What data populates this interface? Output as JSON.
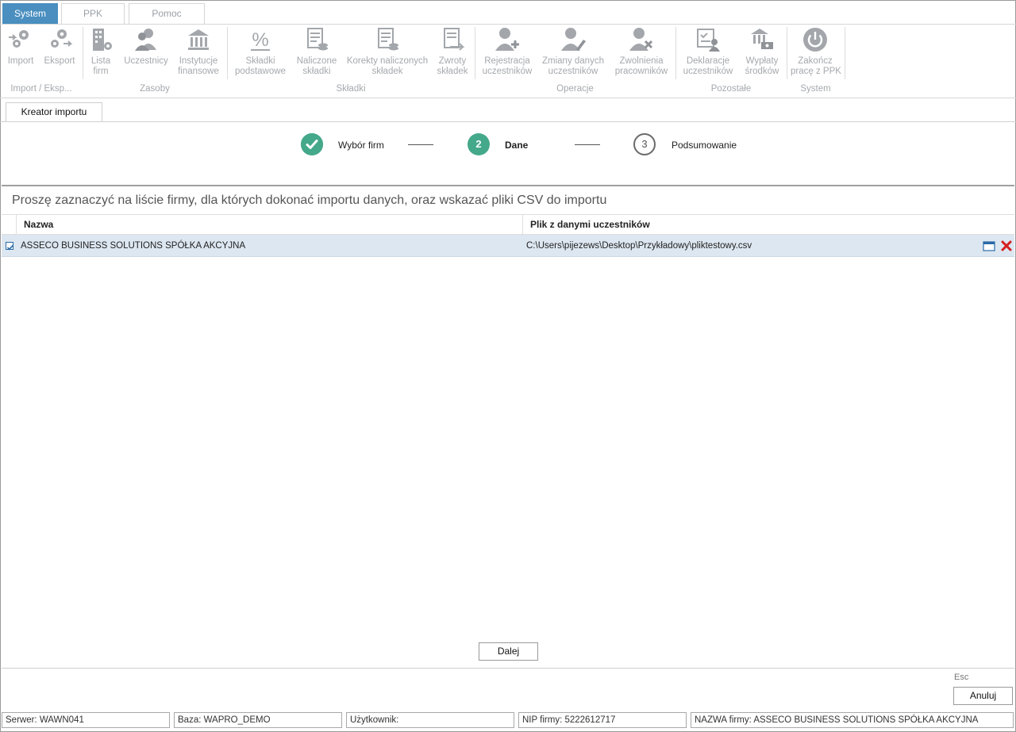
{
  "menu_tabs": [
    "System",
    "PPK",
    "Pomoc"
  ],
  "ribbon": {
    "buttons": [
      {
        "line1": "Import",
        "line2": ""
      },
      {
        "line1": "Eksport",
        "line2": ""
      },
      {
        "line1": "Lista",
        "line2": "firm"
      },
      {
        "line1": "Uczestnicy",
        "line2": ""
      },
      {
        "line1": "Instytucje",
        "line2": "finansowe"
      },
      {
        "line1": "Składki",
        "line2": "podstawowe"
      },
      {
        "line1": "Naliczone",
        "line2": "składki"
      },
      {
        "line1": "Korekty naliczonych",
        "line2": "składek"
      },
      {
        "line1": "Zwroty",
        "line2": "składek"
      },
      {
        "line1": "Rejestracja",
        "line2": "uczestników"
      },
      {
        "line1": "Zmiany danych",
        "line2": "uczestników"
      },
      {
        "line1": "Zwolnienia",
        "line2": "pracowników"
      },
      {
        "line1": "Deklaracje",
        "line2": "uczestników"
      },
      {
        "line1": "Wypłaty",
        "line2": "środków"
      },
      {
        "line1": "Zakończ",
        "line2": "pracę z PPK"
      }
    ],
    "groups": [
      "Import / Eksp...",
      "Zasoby",
      "Składki",
      "Operacje",
      "Pozostałe",
      "System"
    ]
  },
  "content_tab": "Kreator importu",
  "wizard": {
    "steps": [
      {
        "number": "✓",
        "label": "Wybór firm",
        "state": "done"
      },
      {
        "number": "2",
        "label": "Dane",
        "state": "active"
      },
      {
        "number": "3",
        "label": "Podsumowanie",
        "state": "todo"
      }
    ]
  },
  "instruction": "Proszę zaznaczyć na liście firmy, dla których dokonać importu danych, oraz wskazać pliki CSV do importu",
  "grid": {
    "columns": [
      "Nazwa",
      "Plik z danymi uczestników"
    ],
    "rows": [
      {
        "checked": true,
        "name": "ASSECO BUSINESS SOLUTIONS SPÓŁKA AKCYJNA",
        "file": "C:\\Users\\pijezews\\Desktop\\Przykładowy\\pliktestowy.csv"
      }
    ]
  },
  "buttons": {
    "next": "Dalej",
    "cancel": "Anuluj",
    "esc_hint": "Esc"
  },
  "status_bar": {
    "server": "Serwer: WAWN041",
    "database": "Baza: WAPRO_DEMO",
    "user": "Użytkownik:",
    "nip": "NIP firmy: 5222612717",
    "company": "NAZWA firmy: ASSECO BUSINESS SOLUTIONS SPÓŁKA AKCYJNA"
  },
  "colors": {
    "accent": "#4a8fc0",
    "step": "#44a88a",
    "row_selected": "#dde7f1",
    "delete": "#d42020"
  }
}
